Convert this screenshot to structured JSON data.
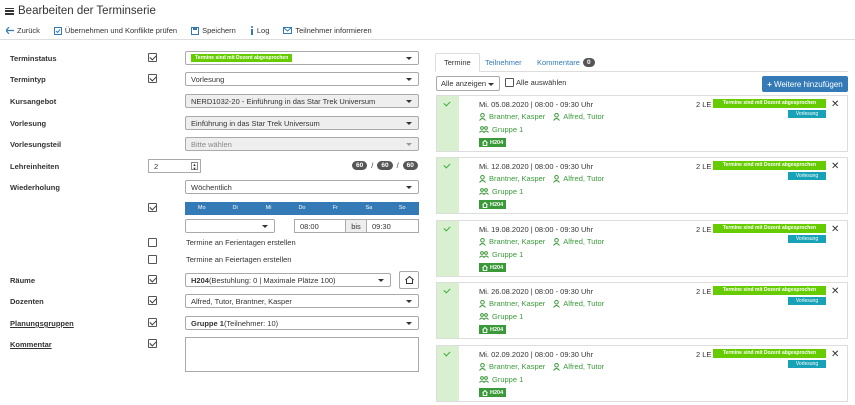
{
  "header": {
    "title": "Bearbeiten der Terminserie"
  },
  "toolbar": {
    "back": "Zurück",
    "apply": "Übernehmen und Konflikte prüfen",
    "save": "Speichern",
    "log": "Log",
    "notify": "Teilnehmer informieren"
  },
  "form": {
    "status": {
      "label": "Terminstatus",
      "value": "Termine sind mit Dozent abgesprochen"
    },
    "type": {
      "label": "Termintyp",
      "value": "Vorlesung"
    },
    "course": {
      "label": "Kursangebot",
      "value": "NERD1032-20 - Einführung in das Star Trek Universum"
    },
    "lecture": {
      "label": "Vorlesung",
      "value": "Einführung in das Star Trek Universum"
    },
    "part": {
      "label": "Vorlesungsteil",
      "placeholder": "Bitte wählen"
    },
    "units": {
      "label": "Lehreinheiten",
      "value": "2",
      "c1": "60",
      "c2": "60",
      "c3": "60",
      "sep": "/"
    },
    "repeat": {
      "label": "Wiederholung",
      "value": "Wöchentlich"
    },
    "days": [
      "Mo",
      "Di",
      "Mi",
      "Do",
      "Fr",
      "Sa",
      "So"
    ],
    "mode": "Individuell",
    "time_from": "08:00",
    "time_sep": "bis",
    "time_to": "09:30",
    "holidays_school": "Termine an Ferientagen erstellen",
    "holidays_public": "Termine an Feiertagen erstellen",
    "rooms": {
      "label": "Räume",
      "name": "H204",
      "detail": " (Bestuhlung: 0 | Maximale Plätze 100)"
    },
    "lecturers": {
      "label": "Dozenten",
      "value": "Alfred, Tutor, Brantner, Kasper"
    },
    "groups": {
      "label": "Planungsgruppen",
      "name": "Gruppe 1",
      "detail": " (Teilnehmer: 10)"
    },
    "comment": {
      "label": "Kommentar"
    }
  },
  "right": {
    "tabs": {
      "t1": "Termine",
      "t2": "Teilnehmer",
      "t3": "Kommentare",
      "t3_count": "0"
    },
    "filter": "Alle anzeigen",
    "select_all": "Alle auswählen",
    "add": "Weitere hinzufügen",
    "cards": [
      {
        "date": "Mi. 05.08.2020 | 08:00 - 09:30 Uhr",
        "le": "2 LE",
        "status": "Termine sind mit Dozent abgesprochen",
        "type": "Vorlesung",
        "doz1": "Brantner, Kasper",
        "doz2": "Alfred, Tutor",
        "group": "Gruppe 1",
        "room": "H204"
      },
      {
        "date": "Mi. 12.08.2020 | 08:00 - 09:30 Uhr",
        "le": "2 LE",
        "status": "Termine sind mit Dozent abgesprochen",
        "type": "Vorlesung",
        "doz1": "Brantner, Kasper",
        "doz2": "Alfred, Tutor",
        "group": "Gruppe 1",
        "room": "H204"
      },
      {
        "date": "Mi. 19.08.2020 | 08:00 - 09:30 Uhr",
        "le": "2 LE",
        "status": "Termine sind mit Dozent abgesprochen",
        "type": "Vorlesung",
        "doz1": "Brantner, Kasper",
        "doz2": "Alfred, Tutor",
        "group": "Gruppe 1",
        "room": "H204"
      },
      {
        "date": "Mi. 26.08.2020 | 08:00 - 09:30 Uhr",
        "le": "2 LE",
        "status": "Termine sind mit Dozent abgesprochen",
        "type": "Vorlesung",
        "doz1": "Brantner, Kasper",
        "doz2": "Alfred, Tutor",
        "group": "Gruppe 1",
        "room": "H204"
      },
      {
        "date": "Mi. 02.09.2020 | 08:00 - 09:30 Uhr",
        "le": "2 LE",
        "status": "Termine sind mit Dozent abgesprochen",
        "type": "Vorlesung",
        "doz1": "Brantner, Kasper",
        "doz2": "Alfred, Tutor",
        "group": "Gruppe 1",
        "room": "H204"
      }
    ]
  },
  "colors": {
    "primary": "#337ab7",
    "success": "#66cc00",
    "info": "#17a2b8",
    "card_check": "#d8f0d0"
  }
}
